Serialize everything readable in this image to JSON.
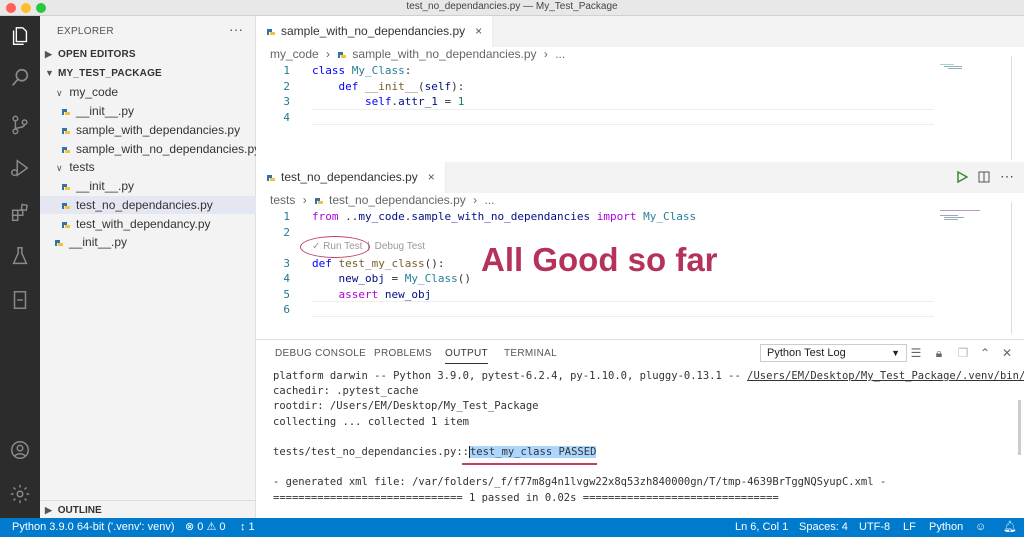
{
  "window": {
    "title": "test_no_dependancies.py — My_Test_Package"
  },
  "sidebar": {
    "header": "EXPLORER",
    "more": "···",
    "open_editors": "OPEN EDITORS",
    "project": "MY_TEST_PACKAGE",
    "tree": [
      {
        "label": "my_code",
        "kind": "folder"
      },
      {
        "label": "__init__.py",
        "kind": "file"
      },
      {
        "label": "sample_with_dependancies.py",
        "kind": "file"
      },
      {
        "label": "sample_with_no_dependancies.py",
        "kind": "file"
      },
      {
        "label": "tests",
        "kind": "folder"
      },
      {
        "label": "__init__.py",
        "kind": "file"
      },
      {
        "label": "test_no_dependancies.py",
        "kind": "file",
        "selected": true
      },
      {
        "label": "test_with_dependancy.py",
        "kind": "file"
      },
      {
        "label": "__init__.py",
        "kind": "file"
      }
    ],
    "outline": "OUTLINE"
  },
  "editor_top": {
    "tab": "sample_with_no_dependancies.py",
    "close": "×",
    "breadcrumb": {
      "folder": "my_code",
      "file": "sample_with_no_dependancies.py",
      "more": "..."
    },
    "line_numbers": [
      "1",
      "2",
      "3",
      "4"
    ]
  },
  "editor_bottom": {
    "tab": "test_no_dependancies.py",
    "close": "×",
    "breadcrumb": {
      "folder": "tests",
      "file": "test_no_dependancies.py",
      "more": "..."
    },
    "line_numbers": [
      "1",
      "2",
      "3",
      "4",
      "5",
      "6"
    ],
    "codelens": {
      "run": "✓ Run Test",
      "sep": "|",
      "debug": "Debug Test"
    },
    "annotation": "All Good so far"
  },
  "panel": {
    "tabs": [
      "DEBUG CONSOLE",
      "PROBLEMS",
      "OUTPUT",
      "TERMINAL"
    ],
    "active_tab": "OUTPUT",
    "channel": "Python Test Log",
    "output": {
      "l1_prefix": "platform darwin -- Python 3.9.0, pytest-6.2.4, py-1.10.0, pluggy-0.13.1 -- ",
      "l1_path": "/Users/EM/Desktop/My_Test_Package/.venv/bin/pyth",
      "l2": "cachedir: .pytest_cache",
      "l3": "rootdir: /Users/EM/Desktop/My_Test_Package",
      "l4": "collecting ... collected 1 item",
      "l6_prefix": "tests/test_no_dependancies.py::",
      "l6_result": "test_my_class PASSED",
      "l8": "- generated xml file: /var/folders/_f/f77m8g4n1lvgw22x8q53zh840000gn/T/tmp-4639BrTggNQSyupC.xml -",
      "l9": "============================== 1 passed in 0.02s ==============================="
    }
  },
  "statusbar": {
    "python": "Python 3.9.0 64-bit ('.venv': venv)",
    "problems": "⊗ 0 ⚠ 0",
    "sync": "↕ 1",
    "position": "Ln 6, Col 1",
    "spaces": "Spaces: 4",
    "encoding": "UTF-8",
    "eol": "LF",
    "language": "Python"
  },
  "colors": {
    "accent": "#007acc",
    "annotation": "#b5335a",
    "activity_bar": "#2c2c2c"
  }
}
